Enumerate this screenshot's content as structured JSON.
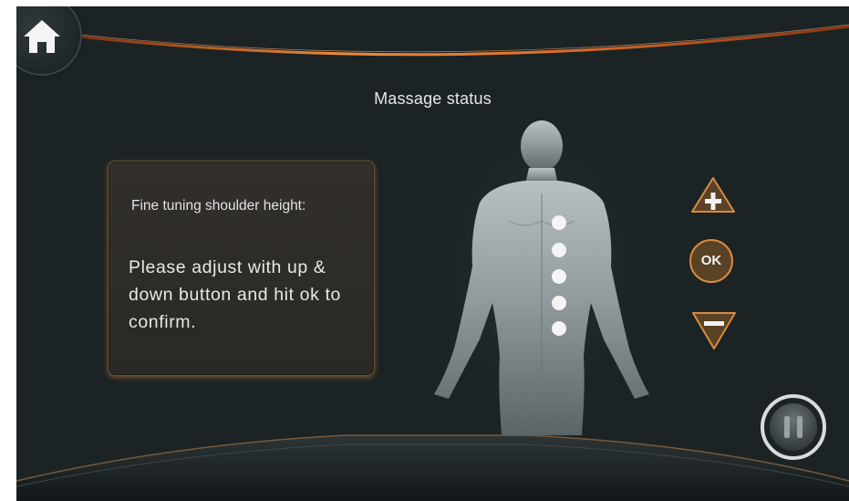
{
  "header": {
    "title": "Massage status"
  },
  "info_panel": {
    "heading": "Fine tuning shoulder height:",
    "instruction": "Please adjust with up & down button and hit ok to confirm."
  },
  "controls": {
    "ok_label": "OK"
  },
  "body_map": {
    "active_points": 5
  },
  "colors": {
    "background": "#1b2325",
    "accent": "#e0722c",
    "panel_border": "#6b5436",
    "button_brown": "#5a4226"
  },
  "icons": {
    "home": "home-icon",
    "plus": "plus-icon",
    "minus": "minus-icon",
    "pause": "pause-icon"
  }
}
